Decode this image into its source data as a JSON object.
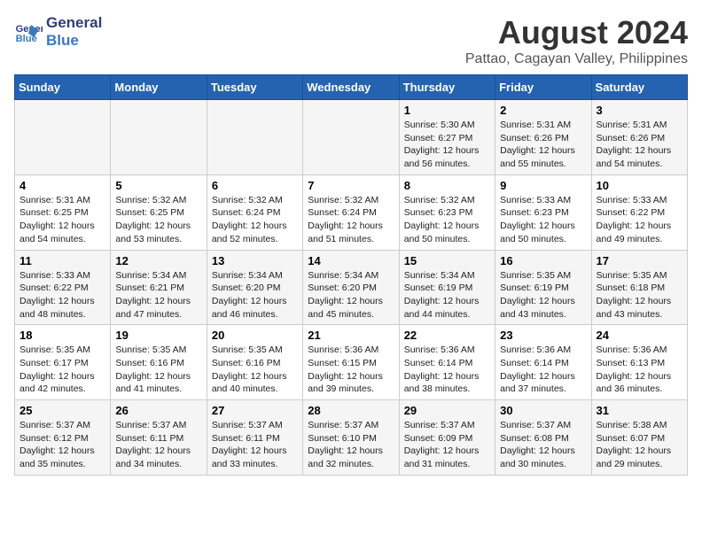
{
  "logo": {
    "line1": "General",
    "line2": "Blue"
  },
  "title": "August 2024",
  "subtitle": "Pattao, Cagayan Valley, Philippines",
  "days_of_week": [
    "Sunday",
    "Monday",
    "Tuesday",
    "Wednesday",
    "Thursday",
    "Friday",
    "Saturday"
  ],
  "weeks": [
    [
      {
        "day": "",
        "info": ""
      },
      {
        "day": "",
        "info": ""
      },
      {
        "day": "",
        "info": ""
      },
      {
        "day": "",
        "info": ""
      },
      {
        "day": "1",
        "info": "Sunrise: 5:30 AM\nSunset: 6:27 PM\nDaylight: 12 hours\nand 56 minutes."
      },
      {
        "day": "2",
        "info": "Sunrise: 5:31 AM\nSunset: 6:26 PM\nDaylight: 12 hours\nand 55 minutes."
      },
      {
        "day": "3",
        "info": "Sunrise: 5:31 AM\nSunset: 6:26 PM\nDaylight: 12 hours\nand 54 minutes."
      }
    ],
    [
      {
        "day": "4",
        "info": "Sunrise: 5:31 AM\nSunset: 6:25 PM\nDaylight: 12 hours\nand 54 minutes."
      },
      {
        "day": "5",
        "info": "Sunrise: 5:32 AM\nSunset: 6:25 PM\nDaylight: 12 hours\nand 53 minutes."
      },
      {
        "day": "6",
        "info": "Sunrise: 5:32 AM\nSunset: 6:24 PM\nDaylight: 12 hours\nand 52 minutes."
      },
      {
        "day": "7",
        "info": "Sunrise: 5:32 AM\nSunset: 6:24 PM\nDaylight: 12 hours\nand 51 minutes."
      },
      {
        "day": "8",
        "info": "Sunrise: 5:32 AM\nSunset: 6:23 PM\nDaylight: 12 hours\nand 50 minutes."
      },
      {
        "day": "9",
        "info": "Sunrise: 5:33 AM\nSunset: 6:23 PM\nDaylight: 12 hours\nand 50 minutes."
      },
      {
        "day": "10",
        "info": "Sunrise: 5:33 AM\nSunset: 6:22 PM\nDaylight: 12 hours\nand 49 minutes."
      }
    ],
    [
      {
        "day": "11",
        "info": "Sunrise: 5:33 AM\nSunset: 6:22 PM\nDaylight: 12 hours\nand 48 minutes."
      },
      {
        "day": "12",
        "info": "Sunrise: 5:34 AM\nSunset: 6:21 PM\nDaylight: 12 hours\nand 47 minutes."
      },
      {
        "day": "13",
        "info": "Sunrise: 5:34 AM\nSunset: 6:20 PM\nDaylight: 12 hours\nand 46 minutes."
      },
      {
        "day": "14",
        "info": "Sunrise: 5:34 AM\nSunset: 6:20 PM\nDaylight: 12 hours\nand 45 minutes."
      },
      {
        "day": "15",
        "info": "Sunrise: 5:34 AM\nSunset: 6:19 PM\nDaylight: 12 hours\nand 44 minutes."
      },
      {
        "day": "16",
        "info": "Sunrise: 5:35 AM\nSunset: 6:19 PM\nDaylight: 12 hours\nand 43 minutes."
      },
      {
        "day": "17",
        "info": "Sunrise: 5:35 AM\nSunset: 6:18 PM\nDaylight: 12 hours\nand 43 minutes."
      }
    ],
    [
      {
        "day": "18",
        "info": "Sunrise: 5:35 AM\nSunset: 6:17 PM\nDaylight: 12 hours\nand 42 minutes."
      },
      {
        "day": "19",
        "info": "Sunrise: 5:35 AM\nSunset: 6:16 PM\nDaylight: 12 hours\nand 41 minutes."
      },
      {
        "day": "20",
        "info": "Sunrise: 5:35 AM\nSunset: 6:16 PM\nDaylight: 12 hours\nand 40 minutes."
      },
      {
        "day": "21",
        "info": "Sunrise: 5:36 AM\nSunset: 6:15 PM\nDaylight: 12 hours\nand 39 minutes."
      },
      {
        "day": "22",
        "info": "Sunrise: 5:36 AM\nSunset: 6:14 PM\nDaylight: 12 hours\nand 38 minutes."
      },
      {
        "day": "23",
        "info": "Sunrise: 5:36 AM\nSunset: 6:14 PM\nDaylight: 12 hours\nand 37 minutes."
      },
      {
        "day": "24",
        "info": "Sunrise: 5:36 AM\nSunset: 6:13 PM\nDaylight: 12 hours\nand 36 minutes."
      }
    ],
    [
      {
        "day": "25",
        "info": "Sunrise: 5:37 AM\nSunset: 6:12 PM\nDaylight: 12 hours\nand 35 minutes."
      },
      {
        "day": "26",
        "info": "Sunrise: 5:37 AM\nSunset: 6:11 PM\nDaylight: 12 hours\nand 34 minutes."
      },
      {
        "day": "27",
        "info": "Sunrise: 5:37 AM\nSunset: 6:11 PM\nDaylight: 12 hours\nand 33 minutes."
      },
      {
        "day": "28",
        "info": "Sunrise: 5:37 AM\nSunset: 6:10 PM\nDaylight: 12 hours\nand 32 minutes."
      },
      {
        "day": "29",
        "info": "Sunrise: 5:37 AM\nSunset: 6:09 PM\nDaylight: 12 hours\nand 31 minutes."
      },
      {
        "day": "30",
        "info": "Sunrise: 5:37 AM\nSunset: 6:08 PM\nDaylight: 12 hours\nand 30 minutes."
      },
      {
        "day": "31",
        "info": "Sunrise: 5:38 AM\nSunset: 6:07 PM\nDaylight: 12 hours\nand 29 minutes."
      }
    ]
  ]
}
